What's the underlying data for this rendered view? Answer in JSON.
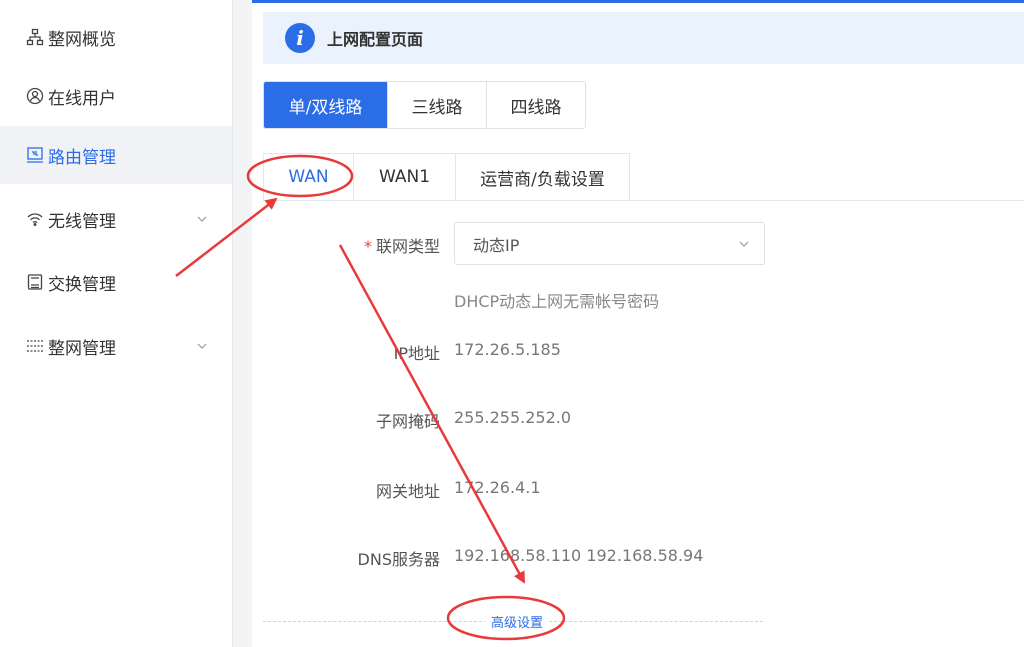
{
  "sidebar": {
    "items": [
      {
        "label": "整网概览",
        "icon": "network-topology-icon"
      },
      {
        "label": "在线用户",
        "icon": "user-circle-icon"
      },
      {
        "label": "路由管理",
        "icon": "router-icon",
        "active": true
      },
      {
        "label": "无线管理",
        "icon": "wifi-icon",
        "expandable": true
      },
      {
        "label": "交换管理",
        "icon": "switch-icon"
      },
      {
        "label": "整网管理",
        "icon": "settings-sliders-icon",
        "expandable": true
      }
    ]
  },
  "header": {
    "info_icon": "info-icon",
    "info_glyph": "i",
    "title": "上网配置页面"
  },
  "line_mode": {
    "options": [
      "单/双线路",
      "三线路",
      "四线路"
    ],
    "selected": "单/双线路"
  },
  "tabs": {
    "items": [
      "WAN",
      "WAN1",
      "运营商/负载设置"
    ],
    "active": "WAN"
  },
  "form": {
    "connection_type": {
      "required_mark": "*",
      "label": "联网类型",
      "value": "动态IP",
      "hint": "DHCP动态上网无需帐号密码"
    },
    "ip": {
      "label": "IP地址",
      "value": "172.26.5.185"
    },
    "netmask": {
      "label": "子网掩码",
      "value": "255.255.252.0"
    },
    "gateway": {
      "label": "网关地址",
      "value": "172.26.4.1"
    },
    "dns": {
      "label": "DNS服务器",
      "value": "192.168.58.110 192.168.58.94"
    },
    "advanced_link": "高级设置"
  },
  "colors": {
    "accent": "#2b6de6",
    "annotation": "#e8393b",
    "info_bg": "#eaf3fd"
  }
}
